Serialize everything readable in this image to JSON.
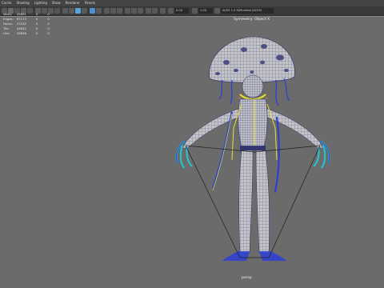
{
  "menubar": {
    "items": [
      "Cache",
      "Shading",
      "Lighting",
      "Show",
      "Renderer",
      "Panels"
    ]
  },
  "toolbar": {
    "value_field": "0.00",
    "scale_field": "1.00",
    "colorspace_field": "ACES 1.0 SDR-video (ACES)"
  },
  "heads_up": {
    "rows": [
      {
        "label": "Verts:",
        "value": "45891",
        "c2": "0",
        "c3": "0"
      },
      {
        "label": "Edges:",
        "value": "67173",
        "c2": "0",
        "c3": "0"
      },
      {
        "label": "Faces:",
        "value": "22152",
        "c2": "0",
        "c3": "0"
      },
      {
        "label": "Tris:",
        "value": "44642",
        "c2": "0",
        "c3": "0"
      },
      {
        "label": "UVs:",
        "value": "28898",
        "c2": "0",
        "c3": "0"
      }
    ]
  },
  "viewport": {
    "symmetry_label": "Symmetry: Object X",
    "camera_label": "persp"
  },
  "colors": {
    "background": "#6b6b6b",
    "mesh_fill": "#c4c4c8",
    "wireframe": "#27295e",
    "rig_highlight_yellow": "#e6e02a",
    "rig_highlight_cyan": "#22c7d6",
    "rig_highlight_blue": "#2b3ed6"
  }
}
